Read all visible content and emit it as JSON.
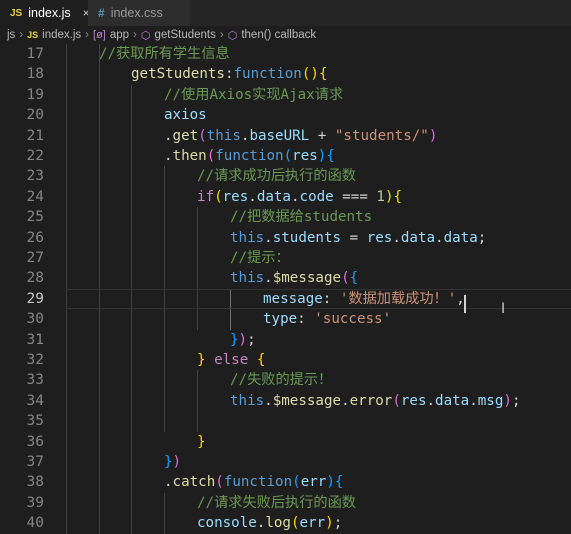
{
  "tabs": [
    {
      "icon": "JS",
      "label": "index.js",
      "close": "×"
    },
    {
      "icon": "#",
      "label": "index.css"
    }
  ],
  "breadcrumb": [
    "js",
    "index.js",
    "app",
    "getStudents",
    "then() callback"
  ],
  "lines": [
    {
      "num": 17,
      "tokens": [
        {
          "t": "//获取所有学生信息",
          "c": "cm"
        }
      ]
    },
    {
      "num": 18,
      "tokens": [
        {
          "t": "getStudents",
          "c": "fn"
        },
        {
          "t": ":",
          "c": "pun"
        },
        {
          "t": "function",
          "c": "kw"
        },
        {
          "t": "(",
          "c": "br1"
        },
        {
          "t": ")",
          "c": "br1"
        },
        {
          "t": "{",
          "c": "br1"
        }
      ]
    },
    {
      "num": 19,
      "tokens": [
        {
          "t": "//使用Axios实现Ajax请求",
          "c": "cm"
        }
      ]
    },
    {
      "num": 20,
      "tokens": [
        {
          "t": "axios",
          "c": "prop"
        }
      ]
    },
    {
      "num": 21,
      "tokens": [
        {
          "t": ".",
          "c": "pun"
        },
        {
          "t": "get",
          "c": "fn"
        },
        {
          "t": "(",
          "c": "br2"
        },
        {
          "t": "this",
          "c": "kw"
        },
        {
          "t": ".",
          "c": "pun"
        },
        {
          "t": "baseURL",
          "c": "prop"
        },
        {
          "t": " + ",
          "c": "pun"
        },
        {
          "t": "\"students/\"",
          "c": "str"
        },
        {
          "t": ")",
          "c": "br2"
        }
      ]
    },
    {
      "num": 22,
      "tokens": [
        {
          "t": ".",
          "c": "pun"
        },
        {
          "t": "then",
          "c": "fn"
        },
        {
          "t": "(",
          "c": "br2"
        },
        {
          "t": "function",
          "c": "kw"
        },
        {
          "t": "(",
          "c": "br3"
        },
        {
          "t": "res",
          "c": "prop"
        },
        {
          "t": ")",
          "c": "br3"
        },
        {
          "t": "{",
          "c": "br3"
        }
      ]
    },
    {
      "num": 23,
      "tokens": [
        {
          "t": "//请求成功后执行的函数",
          "c": "cm"
        }
      ]
    },
    {
      "num": 24,
      "tokens": [
        {
          "t": "if",
          "c": "ctl"
        },
        {
          "t": "(",
          "c": "br1"
        },
        {
          "t": "res",
          "c": "prop"
        },
        {
          "t": ".",
          "c": "pun"
        },
        {
          "t": "data",
          "c": "prop"
        },
        {
          "t": ".",
          "c": "pun"
        },
        {
          "t": "code",
          "c": "prop"
        },
        {
          "t": " === ",
          "c": "pun"
        },
        {
          "t": "1",
          "c": "num"
        },
        {
          "t": ")",
          "c": "br1"
        },
        {
          "t": "{",
          "c": "br1"
        }
      ]
    },
    {
      "num": 25,
      "tokens": [
        {
          "t": "//把数据给students",
          "c": "cm"
        }
      ]
    },
    {
      "num": 26,
      "tokens": [
        {
          "t": "this",
          "c": "kw"
        },
        {
          "t": ".",
          "c": "pun"
        },
        {
          "t": "students",
          "c": "prop"
        },
        {
          "t": " = ",
          "c": "pun"
        },
        {
          "t": "res",
          "c": "prop"
        },
        {
          "t": ".",
          "c": "pun"
        },
        {
          "t": "data",
          "c": "prop"
        },
        {
          "t": ".",
          "c": "pun"
        },
        {
          "t": "data",
          "c": "prop"
        },
        {
          "t": ";",
          "c": "pun"
        }
      ]
    },
    {
      "num": 27,
      "tokens": [
        {
          "t": "//提示：",
          "c": "cm"
        }
      ]
    },
    {
      "num": 28,
      "tokens": [
        {
          "t": "this",
          "c": "kw"
        },
        {
          "t": ".",
          "c": "pun"
        },
        {
          "t": "$message",
          "c": "fn"
        },
        {
          "t": "(",
          "c": "br2"
        },
        {
          "t": "{",
          "c": "br3"
        }
      ]
    },
    {
      "num": 29,
      "tokens": [
        {
          "t": "message",
          "c": "prop"
        },
        {
          "t": ": ",
          "c": "pun"
        },
        {
          "t": "'数据加载成功！'",
          "c": "str"
        },
        {
          "t": ",",
          "c": "pun"
        }
      ],
      "current": true
    },
    {
      "num": 30,
      "tokens": [
        {
          "t": "type",
          "c": "prop"
        },
        {
          "t": ": ",
          "c": "pun"
        },
        {
          "t": "'success'",
          "c": "str"
        }
      ]
    },
    {
      "num": 31,
      "tokens": [
        {
          "t": "}",
          "c": "br3"
        },
        {
          "t": ")",
          "c": "br2"
        },
        {
          "t": ";",
          "c": "pun"
        }
      ]
    },
    {
      "num": 32,
      "tokens": [
        {
          "t": "}",
          "c": "br1"
        },
        {
          "t": " ",
          "c": "pun"
        },
        {
          "t": "else",
          "c": "ctl"
        },
        {
          "t": " ",
          "c": "pun"
        },
        {
          "t": "{",
          "c": "br1"
        }
      ]
    },
    {
      "num": 33,
      "tokens": [
        {
          "t": "//失败的提示！",
          "c": "cm"
        }
      ]
    },
    {
      "num": 34,
      "tokens": [
        {
          "t": "this",
          "c": "kw"
        },
        {
          "t": ".",
          "c": "pun"
        },
        {
          "t": "$message",
          "c": "fn"
        },
        {
          "t": ".",
          "c": "pun"
        },
        {
          "t": "error",
          "c": "fn"
        },
        {
          "t": "(",
          "c": "br2"
        },
        {
          "t": "res",
          "c": "prop"
        },
        {
          "t": ".",
          "c": "pun"
        },
        {
          "t": "data",
          "c": "prop"
        },
        {
          "t": ".",
          "c": "pun"
        },
        {
          "t": "msg",
          "c": "prop"
        },
        {
          "t": ")",
          "c": "br2"
        },
        {
          "t": ";",
          "c": "pun"
        }
      ]
    },
    {
      "num": 35,
      "tokens": []
    },
    {
      "num": 36,
      "tokens": [
        {
          "t": "}",
          "c": "br1"
        }
      ]
    },
    {
      "num": 37,
      "tokens": [
        {
          "t": "}",
          "c": "br3"
        },
        {
          "t": ")",
          "c": "br2"
        }
      ]
    },
    {
      "num": 38,
      "tokens": [
        {
          "t": ".",
          "c": "pun"
        },
        {
          "t": "catch",
          "c": "fn"
        },
        {
          "t": "(",
          "c": "br2"
        },
        {
          "t": "function",
          "c": "kw"
        },
        {
          "t": "(",
          "c": "br3"
        },
        {
          "t": "err",
          "c": "prop"
        },
        {
          "t": ")",
          "c": "br3"
        },
        {
          "t": "{",
          "c": "br3"
        }
      ]
    },
    {
      "num": 39,
      "tokens": [
        {
          "t": "//请求失败后执行的函数",
          "c": "cm"
        }
      ]
    },
    {
      "num": 40,
      "tokens": [
        {
          "t": "console",
          "c": "prop"
        },
        {
          "t": ".",
          "c": "pun"
        },
        {
          "t": "log",
          "c": "fn"
        },
        {
          "t": "(",
          "c": "br1"
        },
        {
          "t": "err",
          "c": "prop"
        },
        {
          "t": ")",
          "c": "br1"
        },
        {
          "t": ";",
          "c": "pun"
        }
      ]
    }
  ]
}
